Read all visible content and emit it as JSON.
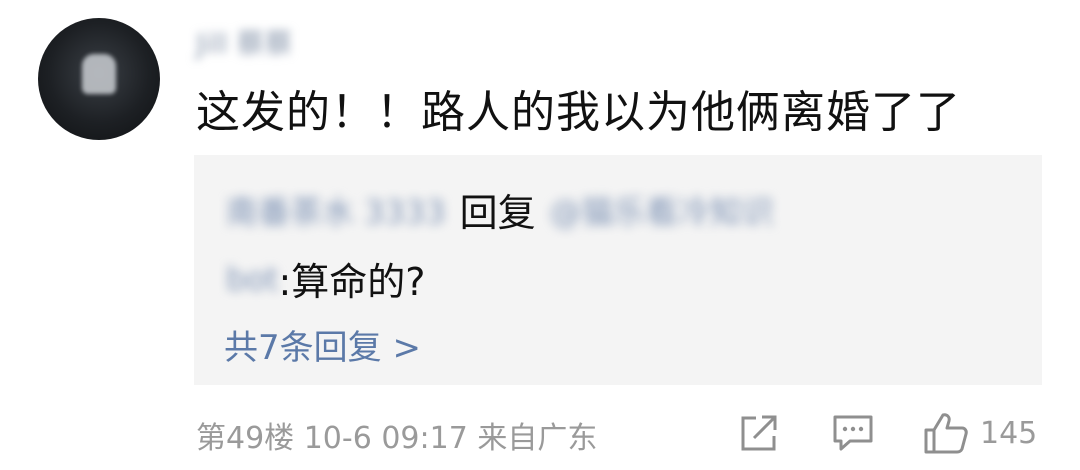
{
  "comment": {
    "username": "Jill 蔡蔡",
    "text": "这发的！！路人的我以为他俩离婚了了"
  },
  "reply": {
    "replier": "南番茶水 3333",
    "verb": "回复",
    "mention_part1": "@猫乐看冷知识",
    "mention_part2": "bot",
    "content": ":算命的?",
    "more_replies": "共7条回复 >"
  },
  "footer": {
    "meta": "第49楼 10-6 09:17 来自广东",
    "like_count": "145"
  },
  "icons": {
    "share": "share-icon",
    "comment": "comment-icon",
    "like": "thumbs-up-icon"
  },
  "colors": {
    "link": "#5b79a8",
    "muted": "#9a9a9a",
    "reply_bg": "#f4f4f4",
    "text": "#111111"
  }
}
